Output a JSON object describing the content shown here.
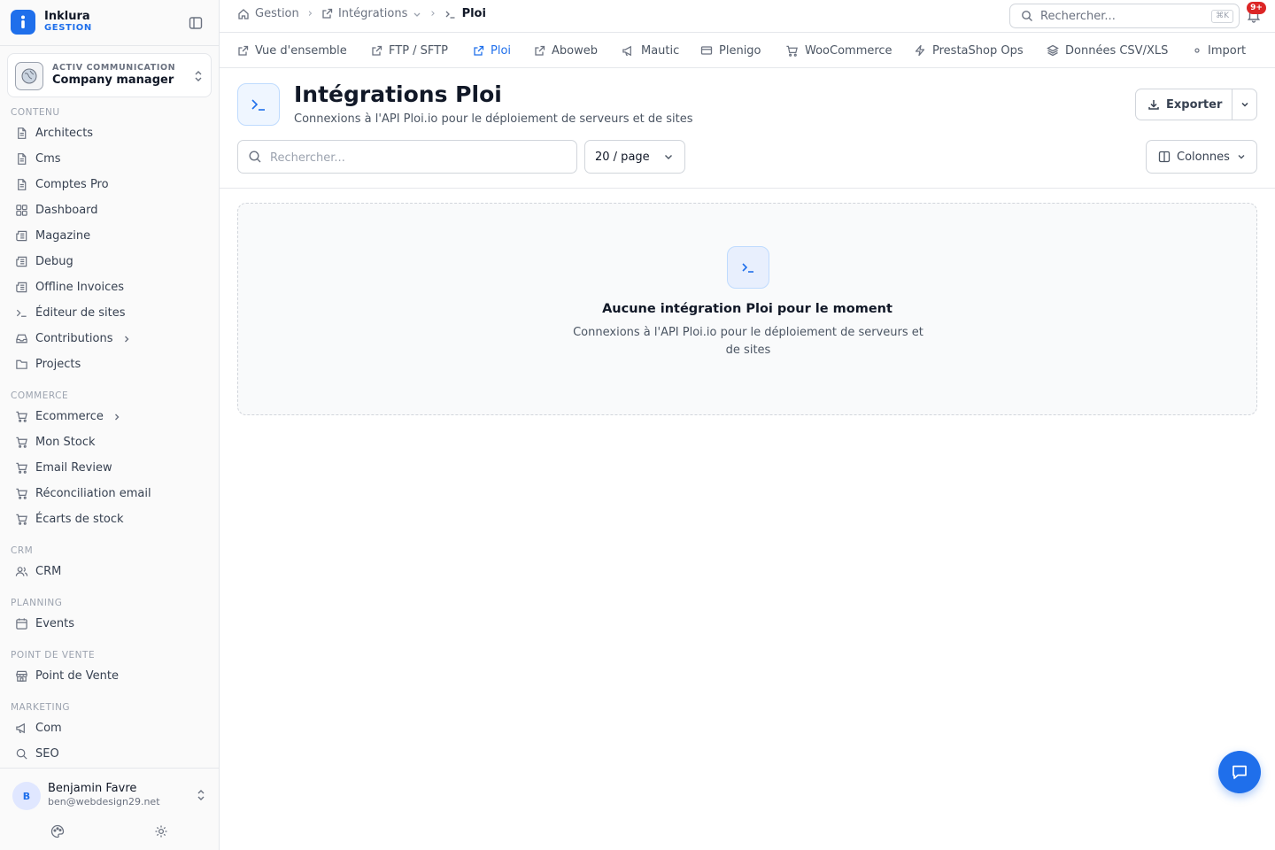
{
  "brand": {
    "name": "Inklura",
    "subtitle": "GESTION"
  },
  "company": {
    "org": "ACTIV COMMUNICATION",
    "role": "Company manager"
  },
  "sidebar": {
    "sections": [
      {
        "title": "CONTENU",
        "items": [
          {
            "label": "Architects",
            "icon": "document-icon"
          },
          {
            "label": "Cms",
            "icon": "document-icon"
          },
          {
            "label": "Comptes Pro",
            "icon": "document-icon"
          },
          {
            "label": "Dashboard",
            "icon": "grid-icon"
          },
          {
            "label": "Magazine",
            "icon": "newspaper-icon"
          },
          {
            "label": "Debug",
            "icon": "newspaper-icon"
          },
          {
            "label": "Offline Invoices",
            "icon": "newspaper-icon"
          },
          {
            "label": "Éditeur de sites",
            "icon": "terminal-icon"
          },
          {
            "label": "Contributions",
            "icon": "inbox-icon",
            "has_children": true
          },
          {
            "label": "Projects",
            "icon": "folder-icon"
          }
        ]
      },
      {
        "title": "COMMERCE",
        "items": [
          {
            "label": "Ecommerce",
            "icon": "cart-icon",
            "has_children": true
          },
          {
            "label": "Mon Stock",
            "icon": "cart-icon"
          },
          {
            "label": "Email Review",
            "icon": "cart-icon"
          },
          {
            "label": "Réconciliation email",
            "icon": "cart-icon"
          },
          {
            "label": "Écarts de stock",
            "icon": "cart-icon"
          }
        ]
      },
      {
        "title": "CRM",
        "items": [
          {
            "label": "CRM",
            "icon": "users-icon"
          }
        ]
      },
      {
        "title": "PLANNING",
        "items": [
          {
            "label": "Events",
            "icon": "calendar-icon"
          }
        ]
      },
      {
        "title": "POINT DE VENTE",
        "items": [
          {
            "label": "Point de Vente",
            "icon": "store-icon"
          }
        ]
      },
      {
        "title": "MARKETING",
        "items": [
          {
            "label": "Com",
            "icon": "megaphone-icon"
          },
          {
            "label": "SEO",
            "icon": "search-icon"
          }
        ]
      }
    ]
  },
  "user": {
    "initial": "B",
    "name": "Benjamin Favre",
    "email": "ben@webdesign29.net"
  },
  "breadcrumb": {
    "items": [
      "Gestion",
      "Intégrations"
    ],
    "current": "Ploi"
  },
  "global_search": {
    "placeholder": "Rechercher...",
    "shortcut": "⌘K"
  },
  "notifications": {
    "badge": "9+"
  },
  "tabs": [
    {
      "label": "Vue d'ensemble",
      "icon": "external-link-icon"
    },
    {
      "label": "FTP / SFTP",
      "icon": "external-link-icon"
    },
    {
      "label": "Ploi",
      "icon": "external-link-icon",
      "active": true
    },
    {
      "label": "Aboweb",
      "icon": "external-link-icon"
    },
    {
      "label": "Mautic",
      "icon": "megaphone-icon"
    },
    {
      "label": "Plenigo",
      "icon": "card-icon"
    },
    {
      "label": "WooCommerce",
      "icon": "cart-icon"
    },
    {
      "label": "PrestaShop Ops",
      "icon": "bolt-icon"
    },
    {
      "label": "Données CSV/XLS",
      "icon": "layers-icon"
    },
    {
      "label": "Import",
      "icon": "dot-icon"
    }
  ],
  "page": {
    "title": "Intégrations Ploi",
    "subtitle": "Connexions à l'API Ploi.io pour le déploiement de serveurs et de sites",
    "export_label": "Exporter"
  },
  "toolbar": {
    "search_placeholder": "Rechercher...",
    "page_size": "20 / page",
    "columns_label": "Colonnes"
  },
  "empty_state": {
    "title": "Aucune intégration Ploi pour le moment",
    "description": "Connexions à l'API Ploi.io pour le déploiement de serveurs et de sites"
  },
  "colors": {
    "accent": "#1f6feb",
    "badge": "#dc2626"
  }
}
